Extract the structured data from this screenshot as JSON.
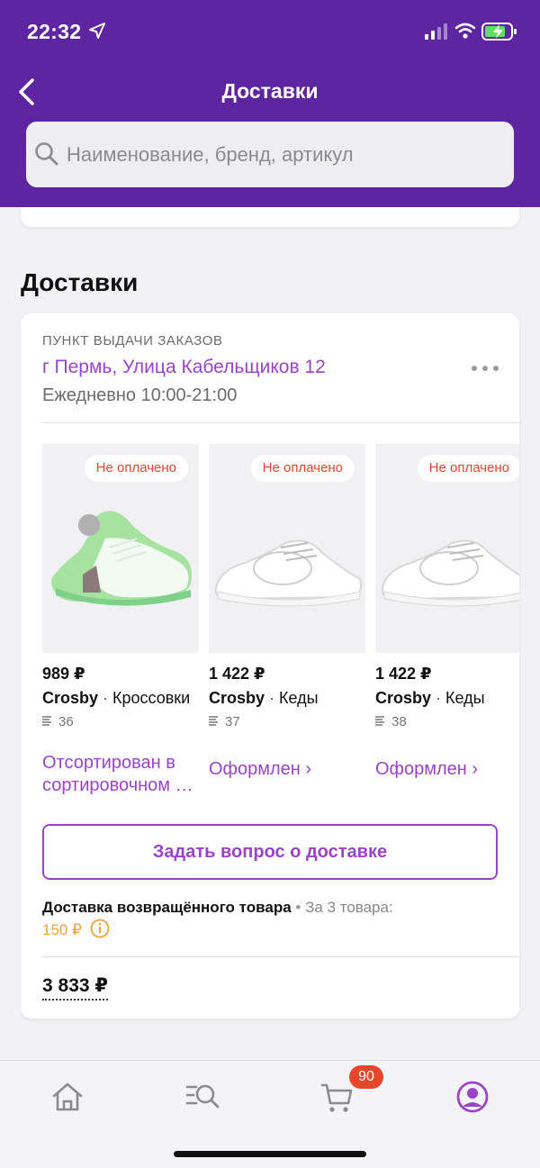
{
  "status_bar": {
    "time": "22:32"
  },
  "header": {
    "title": "Доставки",
    "search_placeholder": "Наименование, бренд, артикул"
  },
  "section_title": "Доставки",
  "delivery": {
    "pickup_label": "ПУНКТ ВЫДАЧИ ЗАКАЗОВ",
    "address": "г Пермь, Улица Кабельщиков 12",
    "hours": "Ежедневно 10:00-21:00",
    "products": [
      {
        "badge": "Не оплачено",
        "price": "989 ₽",
        "brand": "Crosby",
        "name": "Кроссовки",
        "size": "36",
        "status_line1": "Отсортирован в",
        "status_line2": "сортировочном центре",
        "status": "",
        "accent": "#a7e3a0"
      },
      {
        "badge": "Не оплачено",
        "price": "1 422 ₽",
        "brand": "Crosby",
        "name": "Кеды",
        "size": "37",
        "status_line1": "",
        "status_line2": "",
        "status": "Оформлен ›",
        "accent": "#ffffff"
      },
      {
        "badge": "Не оплачено",
        "price": "1 422 ₽",
        "brand": "Crosby",
        "name": "Кеды",
        "size": "38",
        "status_line1": "",
        "status_line2": "",
        "status": "Оформлен ›",
        "accent": "#ffffff"
      }
    ],
    "ask_button": "Задать вопрос о доставке",
    "return_title": "Доставка возвращённого товара",
    "return_separator": "•",
    "return_count": "За 3 товара:",
    "return_price": "150 ₽",
    "total": "3 833 ₽"
  },
  "tabbar": {
    "cart_count": "90",
    "icons": [
      "home-icon",
      "catalog-search-icon",
      "cart-icon",
      "profile-icon"
    ],
    "active": "profile-icon"
  },
  "colors": {
    "header_bg": "#5e25a0",
    "accent": "#9a44c9",
    "badge_text": "#e0472f",
    "price_orange": "#f0a23a",
    "cart_badge": "#e5472b"
  }
}
